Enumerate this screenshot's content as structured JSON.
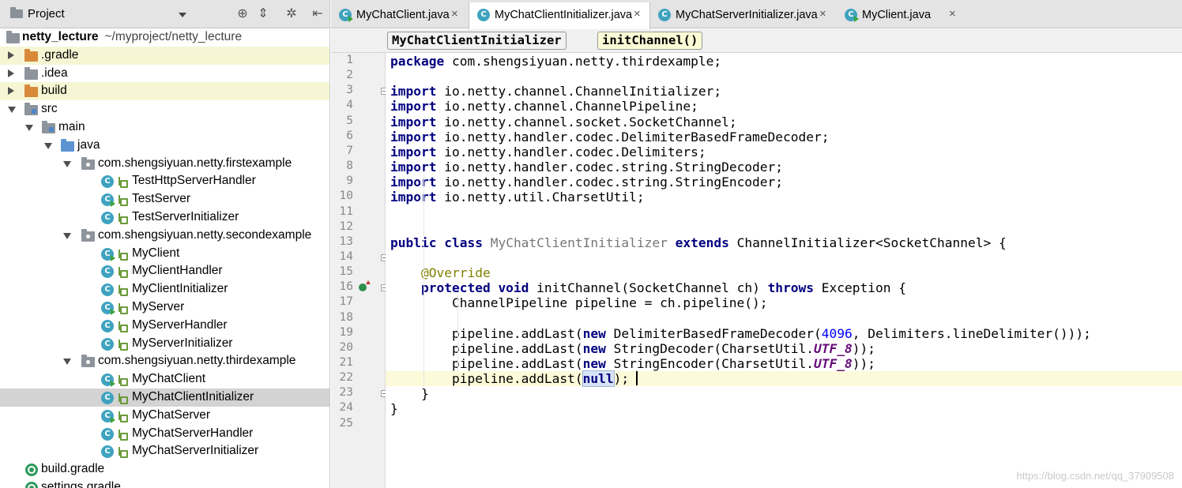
{
  "project_panel": {
    "title": "Project",
    "tree": [
      {
        "label": "netty_lecture",
        "path": "~/myproject/netty_lecture",
        "icon": "folder-grey",
        "arrow": "none",
        "bold": true
      },
      {
        "label": ".gradle",
        "icon": "folder-orange",
        "arrow": "right",
        "highlight": true
      },
      {
        "label": ".idea",
        "icon": "folder-grey",
        "arrow": "right"
      },
      {
        "label": "build",
        "icon": "folder-orange",
        "arrow": "right",
        "highlight": true
      },
      {
        "label": "src",
        "icon": "folder-grey",
        "arrow": "down"
      },
      {
        "label": "main",
        "icon": "folder-grey",
        "arrow": "down"
      },
      {
        "label": "java",
        "icon": "folder-blue",
        "arrow": "down"
      },
      {
        "label": "com.shengsiyuan.netty.firstexample",
        "icon": "package",
        "arrow": "down"
      },
      {
        "label": "TestHttpServerHandler",
        "icon": "class"
      },
      {
        "label": "TestServer",
        "icon": "class-runnable"
      },
      {
        "label": "TestServerInitializer",
        "icon": "class"
      },
      {
        "label": "com.shengsiyuan.netty.secondexample",
        "icon": "package",
        "arrow": "down"
      },
      {
        "label": "MyClient",
        "icon": "class-runnable"
      },
      {
        "label": "MyClientHandler",
        "icon": "class"
      },
      {
        "label": "MyClientInitializer",
        "icon": "class"
      },
      {
        "label": "MyServer",
        "icon": "class-runnable"
      },
      {
        "label": "MyServerHandler",
        "icon": "class"
      },
      {
        "label": "MyServerInitializer",
        "icon": "class"
      },
      {
        "label": "com.shengsiyuan.netty.thirdexample",
        "icon": "package",
        "arrow": "down"
      },
      {
        "label": "MyChatClient",
        "icon": "class-runnable"
      },
      {
        "label": "MyChatClientInitializer",
        "icon": "class",
        "selected": true
      },
      {
        "label": "MyChatServer",
        "icon": "class-runnable"
      },
      {
        "label": "MyChatServerHandler",
        "icon": "class"
      },
      {
        "label": "MyChatServerInitializer",
        "icon": "class"
      },
      {
        "label": "build.gradle",
        "icon": "gradle"
      },
      {
        "label": "settings.gradle",
        "icon": "gradle"
      }
    ]
  },
  "tabs": [
    {
      "label": "MyChatClient.java",
      "icon": "class-runnable",
      "active": false
    },
    {
      "label": "MyChatClientInitializer.java",
      "icon": "class",
      "active": true
    },
    {
      "label": "MyChatServerInitializer.java",
      "icon": "class",
      "active": false
    },
    {
      "label": "MyClient.java",
      "icon": "class-runnable",
      "active": false
    }
  ],
  "tab_close_glyph": "×",
  "breadcrumbs": [
    "MyChatClientInitializer",
    "initChannel()"
  ],
  "code": [
    [
      [
        "kw",
        "package"
      ],
      [
        "t",
        " com.shengsiyuan.netty.thirdexample;"
      ]
    ],
    [],
    [
      [
        "kw",
        "import"
      ],
      [
        "t",
        " io.netty.channel.ChannelInitializer;"
      ]
    ],
    [
      [
        "kw",
        "import"
      ],
      [
        "t",
        " io.netty.channel.ChannelPipeline;"
      ]
    ],
    [
      [
        "kw",
        "import"
      ],
      [
        "t",
        " io.netty.channel.socket.SocketChannel;"
      ]
    ],
    [
      [
        "kw",
        "import"
      ],
      [
        "t",
        " io.netty.handler.codec.DelimiterBasedFrameDecoder;"
      ]
    ],
    [
      [
        "kw",
        "import"
      ],
      [
        "t",
        " io.netty.handler.codec.Delimiters;"
      ]
    ],
    [
      [
        "kw",
        "import"
      ],
      [
        "t",
        " io.netty.handler.codec.string.StringDecoder;"
      ]
    ],
    [
      [
        "kw",
        "import"
      ],
      [
        "t",
        " io.netty.handler.codec.string.StringEncoder;"
      ]
    ],
    [
      [
        "kw",
        "import"
      ],
      [
        "t",
        " io.netty.util.CharsetUtil;"
      ]
    ],
    [],
    [],
    [
      [
        "kw",
        "public class"
      ],
      [
        "t",
        " "
      ],
      [
        "cls-decl",
        "MyChatClientInitializer"
      ],
      [
        "t",
        " "
      ],
      [
        "kw",
        "extends"
      ],
      [
        "t",
        " ChannelInitializer<SocketChannel> {"
      ]
    ],
    [],
    [
      [
        "t",
        "    "
      ],
      [
        "ann",
        "@Override"
      ]
    ],
    [
      [
        "t",
        "    "
      ],
      [
        "kw",
        "protected void"
      ],
      [
        "t",
        " initChannel(SocketChannel ch) "
      ],
      [
        "kw",
        "throws"
      ],
      [
        "t",
        " Exception {"
      ]
    ],
    [
      [
        "t",
        "        ChannelPipeline pipeline = ch.pipeline();"
      ]
    ],
    [],
    [
      [
        "t",
        "        pipeline.addLast("
      ],
      [
        "kw",
        "new"
      ],
      [
        "t",
        " DelimiterBasedFrameDecoder("
      ],
      [
        "num",
        "4096"
      ],
      [
        "t",
        ", Delimiters.lineDelimiter()));"
      ]
    ],
    [
      [
        "t",
        "        pipeline.addLast("
      ],
      [
        "kw",
        "new"
      ],
      [
        "t",
        " StringDecoder(CharsetUtil."
      ],
      [
        "const",
        "UTF_8"
      ],
      [
        "t",
        "));"
      ]
    ],
    [
      [
        "t",
        "        pipeline.addLast("
      ],
      [
        "kw",
        "new"
      ],
      [
        "t",
        " StringEncoder(CharsetUtil."
      ],
      [
        "const",
        "UTF_8"
      ],
      [
        "t",
        "));"
      ]
    ],
    [
      [
        "t",
        "        pipeline.addLast("
      ],
      [
        "kwnull",
        "null"
      ],
      [
        "t",
        ");"
      ]
    ],
    [
      [
        "t",
        "    }"
      ]
    ],
    [
      [
        "t",
        "}"
      ]
    ],
    []
  ],
  "current_line": 22,
  "watermark": "https://blog.csdn.net/qq_37909508"
}
